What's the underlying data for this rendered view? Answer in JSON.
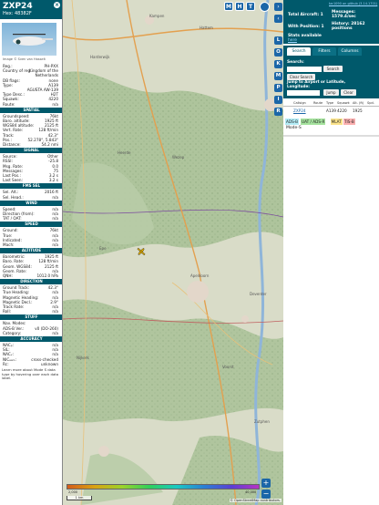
{
  "info": {
    "callsign": "ZXP24",
    "hex_label": "Hex: 48382F",
    "close_glyph": "×",
    "photo_credit": "Image © Sven van Hasselt",
    "fields_top": [
      {
        "label": "Reg.:",
        "value": "PH-PXX"
      },
      {
        "label": "Country of reg.:",
        "value": "Kingdom of the"
      },
      {
        "label": "",
        "value": "Netherlands"
      },
      {
        "label": "DB flags:",
        "value": "none"
      },
      {
        "label": "Type:",
        "value": "A139"
      },
      {
        "label": "",
        "value": "AGUSTA AW-139"
      },
      {
        "label": "Type Desc.:",
        "value": "H2T"
      },
      {
        "label": "Squawk:",
        "value": "4220"
      },
      {
        "label": "Route:",
        "value": "n/a"
      }
    ],
    "sections": {
      "spatial": "SPATIAL",
      "signal": "SIGNAL",
      "fms": "FMS SEL",
      "wind": "WIND",
      "speed": "SPEED",
      "altitude": "ALTITUDE",
      "direction": "DIRECTION",
      "stuff": "STUFF",
      "accuracy": "ACCURACY"
    },
    "spatial": [
      {
        "label": "Groundspeed:",
        "value": "76kt"
      },
      {
        "label": "Baro. altitude:",
        "value": "1925 ft"
      },
      {
        "label": "WGS84 altitude:",
        "value": "2125 ft"
      },
      {
        "label": "Vert. Rate:",
        "value": "128 ft/min"
      },
      {
        "label": "Track:",
        "value": "42.3°"
      },
      {
        "label": "Pos.:",
        "value": "52.278°, 5.843°"
      },
      {
        "label": "Distance:",
        "value": "54.2 nmi"
      }
    ],
    "signal": [
      {
        "label": "Source:",
        "value": "Other"
      },
      {
        "label": "RSSI:",
        "value": "-25.8"
      },
      {
        "label": "Msg. Rate:",
        "value": "0.0"
      },
      {
        "label": "Messages:",
        "value": "75"
      },
      {
        "label": "Last Pos.:",
        "value": "3.2 s"
      },
      {
        "label": "Last Seen:",
        "value": "3.2 s"
      }
    ],
    "fms": [
      {
        "label": "Sel. Alt.:",
        "value": "2016 ft"
      },
      {
        "label": "Sel. Head.:",
        "value": "n/a"
      }
    ],
    "wind": [
      {
        "label": "Speed:",
        "value": "n/a"
      },
      {
        "label": "Direction (from):",
        "value": "n/a"
      },
      {
        "label": "TAT / OAT:",
        "value": "n/a"
      }
    ],
    "speed": [
      {
        "label": "Ground:",
        "value": "76kt"
      },
      {
        "label": "True:",
        "value": "n/a"
      },
      {
        "label": "Indicated:",
        "value": "n/a"
      },
      {
        "label": "Mach:",
        "value": "n/a"
      }
    ],
    "altitude": [
      {
        "label": "Barometric:",
        "value": "1925 ft"
      },
      {
        "label": "Baro. Rate:",
        "value": "128 ft/min"
      },
      {
        "label": "Geom. WGS84:",
        "value": "2125 ft"
      },
      {
        "label": "Geom. Rate:",
        "value": "n/a"
      },
      {
        "label": "QNH:",
        "value": "1012.0 hPa"
      }
    ],
    "direction": [
      {
        "label": "Ground Track:",
        "value": "42.3°"
      },
      {
        "label": "True Heading:",
        "value": "n/a"
      },
      {
        "label": "Magnetic Heading:",
        "value": "n/a"
      },
      {
        "label": "Magnetic Decl.:",
        "value": "2.9°"
      },
      {
        "label": "Track Rate:",
        "value": "n/a"
      },
      {
        "label": "Roll:",
        "value": "n/a"
      }
    ],
    "stuff": [
      {
        "label": "Nav. Modes:",
        "value": ""
      },
      {
        "label": "ADS-B Ver.:",
        "value": "v0 (DO-260)"
      },
      {
        "label": "Category:",
        "value": "n/a"
      }
    ],
    "accuracy": [
      {
        "label": "NACₚ:",
        "value": "n/a"
      },
      {
        "label": "SIL:",
        "value": "n/a"
      },
      {
        "label": "NACᵥ:",
        "value": "n/a"
      },
      {
        "label": "NICₔₐᵣₒ:",
        "value": "cross-checked"
      },
      {
        "label": "Rᴄ:",
        "value": "unknown"
      }
    ],
    "footer": "Learn more about Mode S data type by hovering over each data label."
  },
  "map": {
    "labels": [
      "Kampen",
      "Hattem",
      "Heerde",
      "Epe",
      "Apeldoorn",
      "Deventer",
      "Zutphen",
      "Voorst",
      "Nijkerk",
      "Harderwijk",
      "Wezep"
    ],
    "scale": "1 km",
    "attribution": "© OpenStreetMap contributors.",
    "zoom_in": "+",
    "zoom_out": "−",
    "legend_left": "2,000",
    "legend_right": "40,000"
  },
  "right": {
    "top_buttons": [
      "M",
      "H",
      "T"
    ],
    "version_link": "tar1090 on github (3.14.1701)",
    "stats": {
      "total_label": "Total Aircraft:",
      "total_value": "1",
      "messages_label": "Messages:",
      "messages_value": "1579.4/sec",
      "withpos_label": "With Position:",
      "withpos_value": "1",
      "history_label": "History:",
      "history_value": "28162 positions",
      "stats_label": "Stats available",
      "stats_link": "here"
    },
    "side_buttons": [
      "L",
      "O",
      "K",
      "M",
      "P",
      "I",
      "R"
    ],
    "tabs": [
      "Search",
      "Filters",
      "Columns"
    ],
    "search": {
      "label": "Search:",
      "placeholder": "",
      "button": "Search",
      "clear": "Clear Search",
      "jump_label": "Jump to Airport or Latitude, Longitude:",
      "jump_button": "Jump",
      "jump_clear": "Clear"
    },
    "table": {
      "headers": [
        "Callsign",
        "Route",
        "Type",
        "Squawk",
        "Alt. (ft)",
        "Spd."
      ],
      "rows": [
        {
          "callsign": "ZXP24",
          "route": "",
          "type": "A139",
          "squawk": "4220",
          "alt": "1925",
          "spd": ""
        }
      ]
    },
    "legend": [
      "ADS-B",
      "UAT / ADS-R",
      "MLAT",
      "TIS-B"
    ],
    "modes": "Mode-S"
  },
  "colors": {
    "accent": "#00596b",
    "button": "#1b66a8",
    "adsb": "#b3ecf6",
    "uat": "#a6e39f",
    "mlat": "#fbe38b",
    "tisb": "#fbb0b0",
    "aircraft": "#f0b800"
  }
}
